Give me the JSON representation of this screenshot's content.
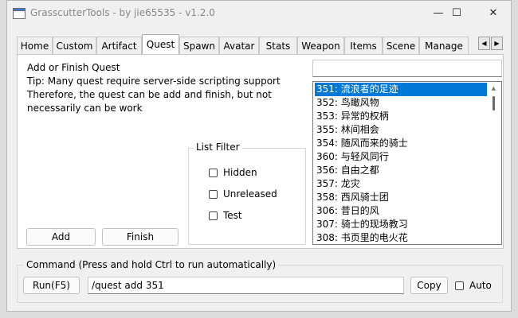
{
  "window": {
    "title": "GrasscutterTools  - by jie65535  - v1.2.0",
    "controls": {
      "minimize": "—",
      "maximize": "☐",
      "close": "✕"
    }
  },
  "tabs": [
    {
      "label": "Home"
    },
    {
      "label": "Custom"
    },
    {
      "label": "Artifact"
    },
    {
      "label": "Quest",
      "active": true
    },
    {
      "label": "Spawn"
    },
    {
      "label": "Avatar"
    },
    {
      "label": "Stats"
    },
    {
      "label": "Weapon"
    },
    {
      "label": "Items"
    },
    {
      "label": "Scene"
    },
    {
      "label": "Manage"
    }
  ],
  "tab_scroll": {
    "left": "◀",
    "right": "▶"
  },
  "quest_panel": {
    "heading": "Add or Finish Quest",
    "tip_line1": "Tip: Many quest require server-side scripting support",
    "tip_line2": "Therefore, the quest can be add and finish, but not",
    "tip_line3": "necessarily can be work",
    "add_label": "Add",
    "finish_label": "Finish",
    "filter_value": "",
    "list_filter": {
      "title": "List Filter",
      "options": [
        {
          "label": "Hidden",
          "checked": false
        },
        {
          "label": "Unreleased",
          "checked": false
        },
        {
          "label": "Test",
          "checked": false
        }
      ]
    },
    "quest_list": [
      "351: 流浪者的足迹",
      "352: 鸟瞰风物",
      "353: 异常的权柄",
      "355: 林间相会",
      "354: 随风而来的骑士",
      "360: 与轻风同行",
      "356: 自由之都",
      "357: 龙灾",
      "358: 西风骑士团",
      "306: 昔日的风",
      "307: 骑士的现场教习",
      "308: 书页里的电火花"
    ],
    "selected_index": 0
  },
  "command": {
    "group_title": "Command (Press and hold Ctrl to run automatically)",
    "run_label": "Run(F5)",
    "value": "/quest add 351",
    "copy_label": "Copy",
    "auto_label": "Auto",
    "auto_checked": false
  }
}
